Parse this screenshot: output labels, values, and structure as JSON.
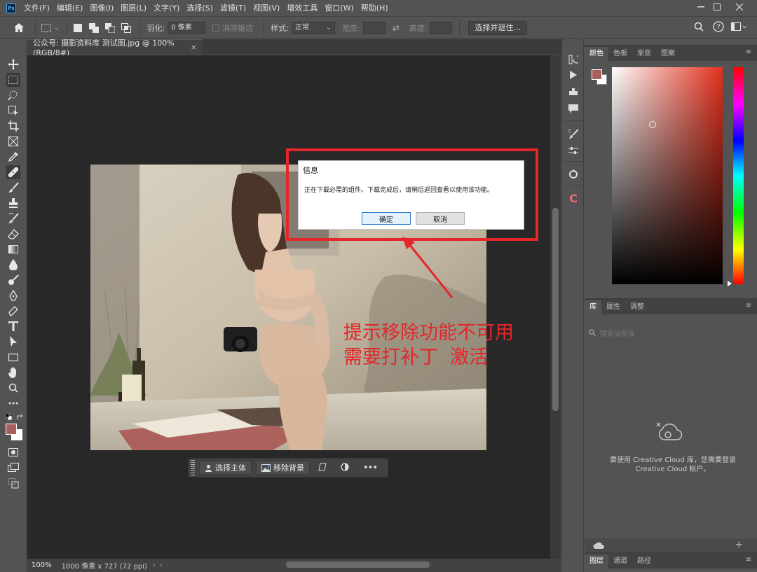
{
  "menubar": {
    "items": [
      "文件(F)",
      "编辑(E)",
      "图像(I)",
      "图层(L)",
      "文字(Y)",
      "选择(S)",
      "滤镜(T)",
      "视图(V)",
      "增效工具",
      "窗口(W)",
      "帮助(H)"
    ]
  },
  "options": {
    "feather_label": "羽化:",
    "feather_value": "0 像素",
    "antialias_label": "消除锯齿",
    "style_label": "样式:",
    "style_value": "正常",
    "width_label": "宽度:",
    "height_label": "高度:",
    "select_mask_label": "选择并遮住..."
  },
  "document": {
    "tab_title": "公众号: 摄影资料库 测试图.jpg @ 100%(RGB/8#)",
    "zoom": "100%",
    "info": "1000 像素 x 727 (72 ppi)"
  },
  "taskbar": {
    "select_subject": "选择主体",
    "remove_bg": "移除背景"
  },
  "dialog": {
    "title": "信息",
    "message": "正在下载必需的组件。下载完成后，请稍后返回查看以使用该功能。",
    "ok": "确定",
    "cancel": "取消"
  },
  "annotation": {
    "line1": "提示移除功能不可用",
    "line2": "需要打补丁  激活"
  },
  "color_panel": {
    "tabs": [
      "颜色",
      "色板",
      "渐变",
      "图案"
    ],
    "foreground": "#a8605f",
    "background": "#ffffff"
  },
  "library_panel": {
    "tabs": [
      "库",
      "属性",
      "调整"
    ],
    "search_placeholder": "搜索当前库",
    "message": "要使用 Creative Cloud 库，您需要登录 Creative Cloud 帐户。"
  },
  "layers_panel": {
    "tabs": [
      "图层",
      "通道",
      "路径"
    ]
  },
  "colors": {
    "accent_red": "#e5262a",
    "canvas_bg": "#282828",
    "ui_bg": "#535353"
  }
}
